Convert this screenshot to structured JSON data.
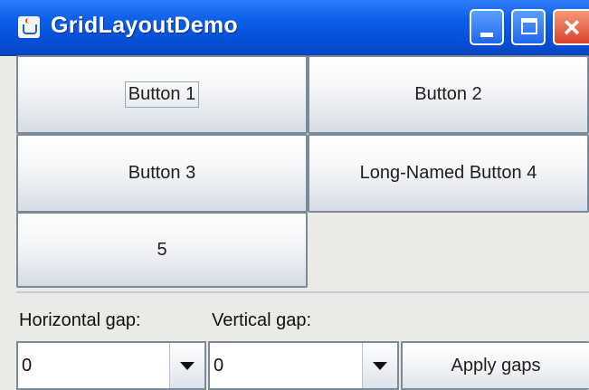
{
  "window": {
    "title": "GridLayoutDemo",
    "app_icon": "java-cup-icon",
    "controls": {
      "minimize": "minimize-icon",
      "maximize": "maximize-icon",
      "close": "close-icon"
    },
    "colors": {
      "titlebar": "#0d5fe8",
      "close": "#d9432a"
    }
  },
  "grid": {
    "buttons": [
      {
        "label": "Button 1"
      },
      {
        "label": "Button 2"
      },
      {
        "label": "Button 3"
      },
      {
        "label": "Long-Named Button 4"
      },
      {
        "label": "5"
      }
    ]
  },
  "controls": {
    "horizontal_gap_label": "Horizontal gap:",
    "vertical_gap_label": "Vertical gap:",
    "horizontal_gap_value": "0",
    "vertical_gap_value": "0",
    "apply_label": "Apply gaps"
  }
}
